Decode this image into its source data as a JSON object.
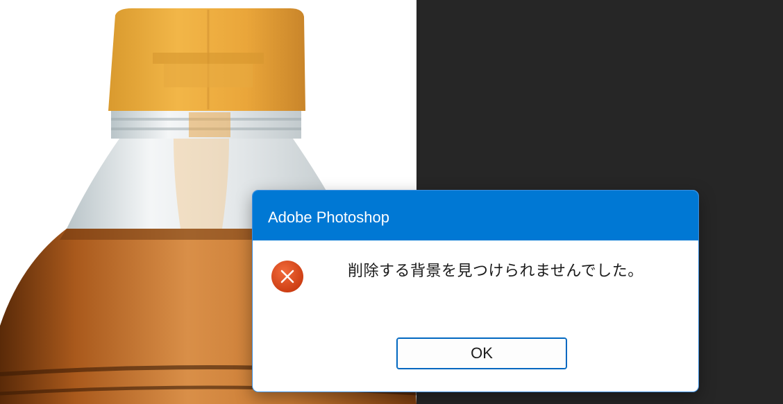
{
  "dialog": {
    "title": "Adobe Photoshop",
    "message": "削除する背景を見つけられませんでした。",
    "ok_label": "OK",
    "icon": "error-icon"
  },
  "colors": {
    "titlebar": "#0078d4",
    "workspace": "#262626",
    "error_icon": "#e0471c"
  }
}
